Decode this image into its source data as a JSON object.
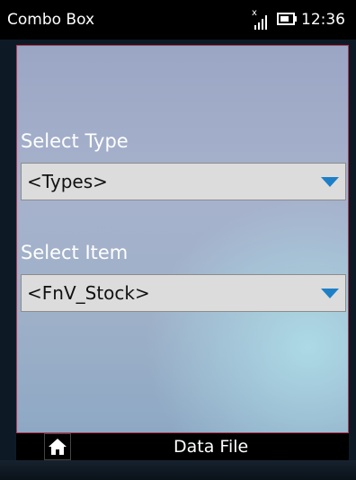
{
  "status_bar": {
    "title": "Combo Box",
    "time": "12:36",
    "signal_icon": "no-signal-icon",
    "battery_icon": "battery-charging-icon"
  },
  "form": {
    "type_label": "Select Type",
    "type_value": "<Types>",
    "item_label": "Select Item",
    "item_value": "<FnV_Stock>"
  },
  "bottom_bar": {
    "home_icon": "home-icon",
    "title": "Data File"
  },
  "colors": {
    "accent_arrow": "#1e7fc7",
    "screen_border": "#b03a56"
  }
}
